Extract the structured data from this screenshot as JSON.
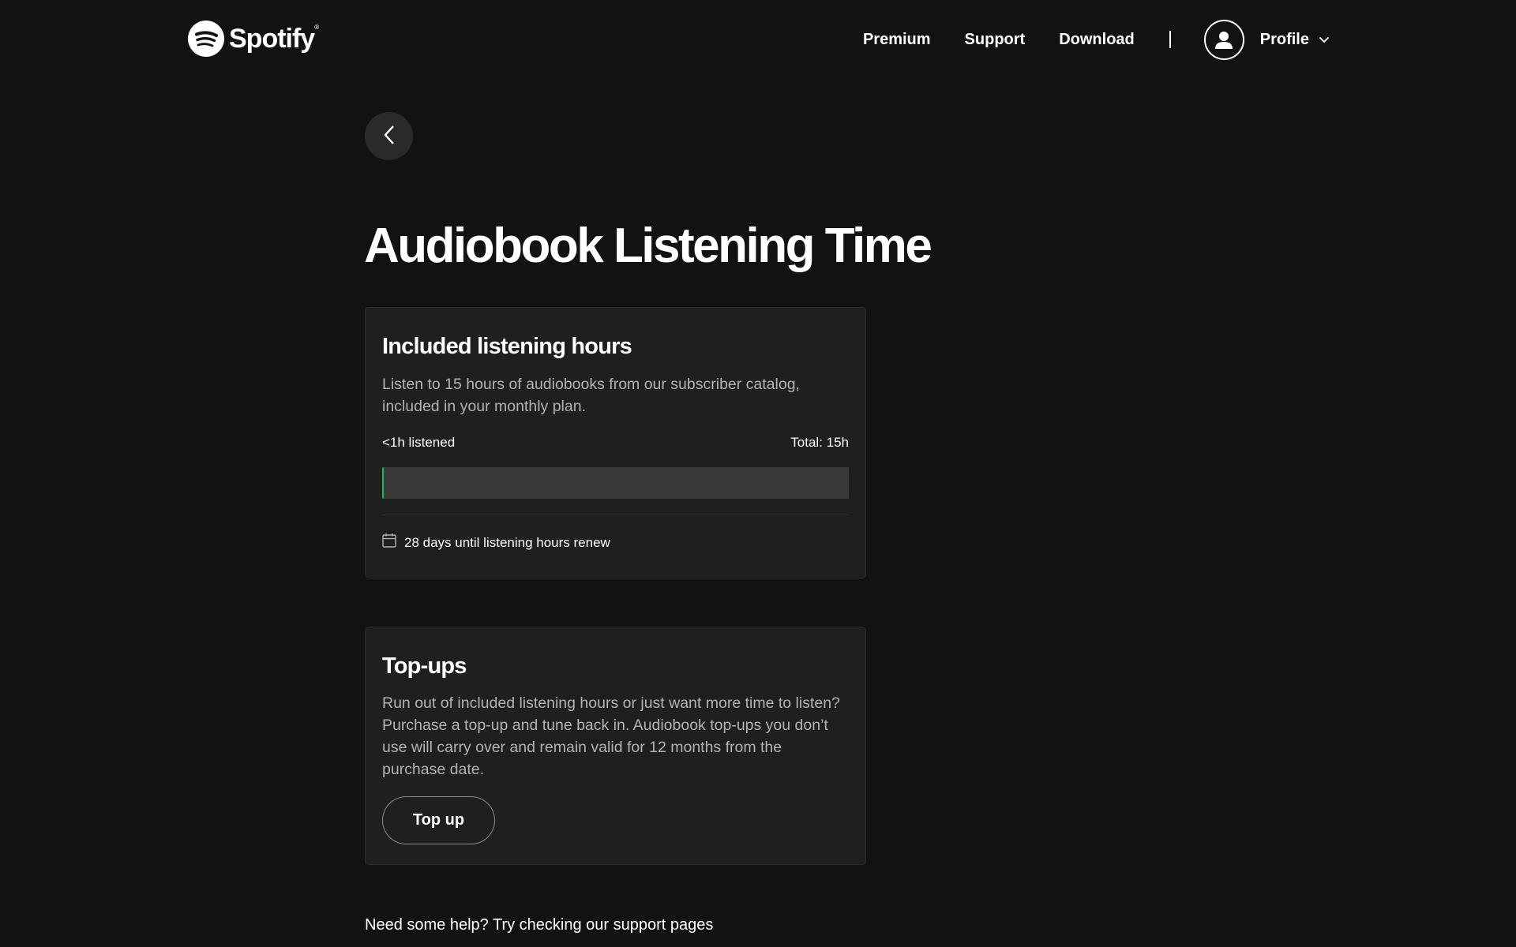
{
  "header": {
    "brand": "Spotify",
    "brand_mark": "®",
    "nav": {
      "premium": "Premium",
      "support": "Support",
      "download": "Download"
    },
    "profile_label": "Profile"
  },
  "page": {
    "title": "Audiobook Listening Time"
  },
  "included": {
    "title": "Included listening hours",
    "description": "Listen to 15 hours of audiobooks from our subscriber catalog, included in your monthly plan.",
    "listened": "<1h listened",
    "total": "Total: 15h",
    "progress_fraction": 0.003,
    "renew_text": "28 days until listening hours renew"
  },
  "topups": {
    "title": "Top-ups",
    "description": "Run out of included listening hours or just want more time to listen? Purchase a top-up and tune back in. Audiobook top-ups you don’t use will carry over and remain valid for 12 months from the purchase date.",
    "button_label": "Top up"
  },
  "footer": {
    "help_text": "Need some help? Try checking our support pages"
  },
  "colors": {
    "background": "#121212",
    "card": "#1f1f1f",
    "accent": "#1db954",
    "muted_text": "#b3b3b3"
  },
  "icons": [
    "spotify-logo-icon",
    "user-icon",
    "chevron-down-icon",
    "chevron-left-icon",
    "calendar-icon"
  ]
}
